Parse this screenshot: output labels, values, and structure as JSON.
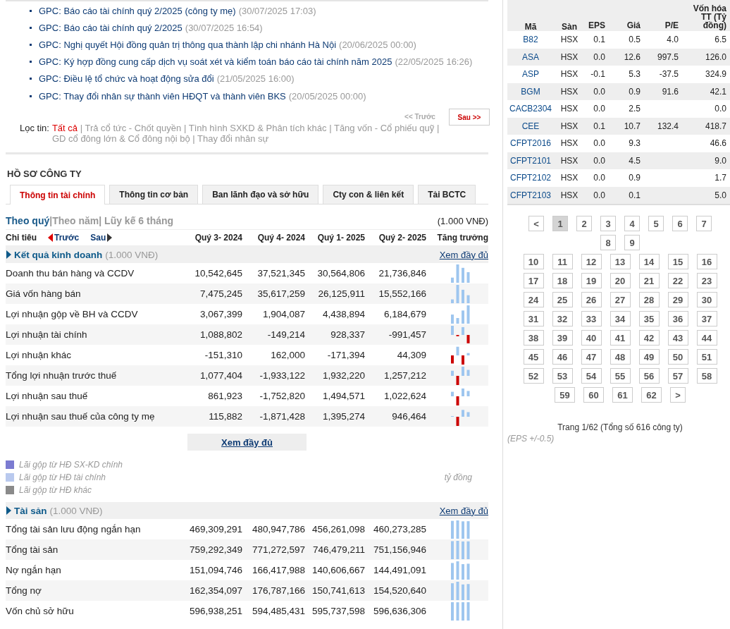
{
  "news": [
    {
      "title": "GPC: Báo cáo tài chính quý 2/2025 (công ty mẹ)",
      "date": "(30/07/2025 17:03)"
    },
    {
      "title": "GPC: Báo cáo tài chính quý 2/2025",
      "date": "(30/07/2025 16:54)"
    },
    {
      "title": "GPC: Nghị quyết Hội đồng quản trị thông qua thành lập chi nhánh Hà Nội",
      "date": "(20/06/2025 00:00)"
    },
    {
      "title": "GPC: Ký hợp đồng cung cấp dịch vụ soát xét và kiểm toán báo cáo tài chính năm 2025",
      "date": "(22/05/2025 16:26)"
    },
    {
      "title": "GPC: Điều lệ tổ chức và hoạt động sửa đổi",
      "date": "(21/05/2025 16:00)"
    },
    {
      "title": "GPC: Thay đổi nhân sự thành viên HĐQT và thành viên BKS",
      "date": "(20/05/2025 00:00)"
    }
  ],
  "news_pager": {
    "prev": "<< Trước",
    "next": "Sau >>"
  },
  "filter": {
    "label": "Lọc tin:",
    "separator": "|",
    "items": [
      {
        "label": "Tất cả",
        "selected": true
      },
      {
        "label": "Trả cổ tức - Chốt quyền",
        "selected": false
      },
      {
        "label": "Tình hình SXKD & Phân tích khác",
        "selected": false
      },
      {
        "label": "Tăng vốn - Cổ phiếu quỹ",
        "selected": false
      },
      {
        "label": "GD cổ đông lớn & Cổ đông nội bộ",
        "selected": false
      },
      {
        "label": "Thay đổi nhân sự",
        "selected": false
      }
    ]
  },
  "profile_title": "HỒ SƠ CÔNG TY",
  "tabs": [
    {
      "label": "Thông tin tài chính",
      "selected": true
    },
    {
      "label": "Thông tin cơ bản",
      "selected": false
    },
    {
      "label": "Ban lãnh đạo và sở hữu",
      "selected": false
    },
    {
      "label": "Cty con & liên kết",
      "selected": false
    },
    {
      "label": "Tải BCTC",
      "selected": false
    }
  ],
  "periods": {
    "separator": "|",
    "items": [
      {
        "label": "Theo quý",
        "selected": true
      },
      {
        "label": "Theo năm",
        "selected": false
      },
      {
        "label": "Lũy kế 6 tháng",
        "selected": false
      }
    ],
    "unit": "(1.000 VNĐ)"
  },
  "table_header": {
    "indicator": "Chỉ tiêu",
    "prev": "Trước",
    "next": "Sau",
    "columns": [
      "Quý 3- 2024",
      "Quý 4- 2024",
      "Quý 1- 2025",
      "Quý 2- 2025"
    ],
    "growth": "Tăng trưởng"
  },
  "sections": [
    {
      "title": "Kết quả kinh doanh",
      "unit": "(1.000 VNĐ)",
      "link": "Xem đầy đủ",
      "rows": [
        {
          "label": "Doanh thu bán hàng và CCDV",
          "values": [
            "10,542,645",
            "37,521,345",
            "30,564,806",
            "21,736,846"
          ]
        },
        {
          "label": "Giá vốn hàng bán",
          "values": [
            "7,475,245",
            "35,617,259",
            "26,125,911",
            "15,552,166"
          ]
        },
        {
          "label": "Lợi nhuận gộp về BH và CCDV",
          "values": [
            "3,067,399",
            "1,904,087",
            "4,438,894",
            "6,184,679"
          ]
        },
        {
          "label": "Lợi nhuận tài chính",
          "values": [
            "1,088,802",
            "-149,214",
            "928,337",
            "-991,457"
          ]
        },
        {
          "label": "Lợi nhuận khác",
          "values": [
            "-151,310",
            "162,000",
            "-171,394",
            "44,309"
          ]
        },
        {
          "label": "Tổng lợi nhuận trước thuế",
          "values": [
            "1,077,404",
            "-1,933,122",
            "1,932,220",
            "1,257,212"
          ]
        },
        {
          "label": "Lợi nhuận sau thuế",
          "values": [
            "861,923",
            "-1,752,820",
            "1,494,571",
            "1,022,624"
          ]
        },
        {
          "label": "Lợi nhuận sau thuế của công ty mẹ",
          "values": [
            "115,882",
            "-1,871,428",
            "1,395,274",
            "946,464"
          ]
        }
      ],
      "more_button": "Xem đầy đủ",
      "legend": {
        "items": [
          {
            "label": "Lãi gộp từ HĐ SX-KD chính",
            "color": "#7b7bd1"
          },
          {
            "label": "Lãi gộp từ HĐ tài chính",
            "color": "#b9c9ee"
          },
          {
            "label": "Lãi gộp từ HĐ khác",
            "color": "#8a8a8a"
          }
        ],
        "unit": "tỷ đồng"
      }
    },
    {
      "title": "Tài sản",
      "unit": "(1.000 VNĐ)",
      "link": "Xem đầy đủ",
      "rows": [
        {
          "label": "Tổng tài sản lưu động ngắn hạn",
          "values": [
            "469,309,291",
            "480,947,786",
            "456,261,098",
            "460,273,285"
          ]
        },
        {
          "label": "Tổng tài sản",
          "values": [
            "759,292,349",
            "771,272,597",
            "746,479,211",
            "751,156,946"
          ]
        },
        {
          "label": "Nợ ngắn hạn",
          "values": [
            "151,094,746",
            "166,417,988",
            "140,606,667",
            "144,491,091"
          ]
        },
        {
          "label": "Tổng nợ",
          "values": [
            "162,354,097",
            "176,787,166",
            "150,741,613",
            "154,520,640"
          ]
        },
        {
          "label": "Vốn chủ sở hữu",
          "values": [
            "596,938,251",
            "594,485,431",
            "595,737,598",
            "596,636,306"
          ]
        }
      ]
    }
  ],
  "stocks": {
    "columns": [
      "Mã",
      "Sàn",
      "EPS",
      "Giá",
      "P/E",
      "Vốn hóa TT (Tỷ đồng)"
    ],
    "rows": [
      {
        "code": "B82",
        "exchange": "HSX",
        "eps": "0.1",
        "price": "0.5",
        "pe": "4.0",
        "cap": "6.5"
      },
      {
        "code": "ASA",
        "exchange": "HSX",
        "eps": "0.0",
        "price": "12.6",
        "pe": "997.5",
        "cap": "126.0"
      },
      {
        "code": "ASP",
        "exchange": "HSX",
        "eps": "-0.1",
        "price": "5.3",
        "pe": "-37.5",
        "cap": "324.9"
      },
      {
        "code": "BGM",
        "exchange": "HSX",
        "eps": "0.0",
        "price": "0.9",
        "pe": "91.6",
        "cap": "42.1"
      },
      {
        "code": "CACB2304",
        "exchange": "HSX",
        "eps": "0.0",
        "price": "2.5",
        "cap": "0.0"
      },
      {
        "code": "CEE",
        "exchange": "HSX",
        "eps": "0.1",
        "price": "10.7",
        "pe": "132.4",
        "cap": "418.7"
      },
      {
        "code": "CFPT2016",
        "exchange": "HSX",
        "eps": "0.0",
        "price": "9.3",
        "cap": "46.6"
      },
      {
        "code": "CFPT2101",
        "exchange": "HSX",
        "eps": "0.0",
        "price": "4.5",
        "cap": "9.0"
      },
      {
        "code": "CFPT2102",
        "exchange": "HSX",
        "eps": "0.0",
        "price": "0.9",
        "cap": "1.7"
      },
      {
        "code": "CFPT2103",
        "exchange": "HSX",
        "eps": "0.0",
        "price": "0.1",
        "cap": "5.0"
      }
    ]
  },
  "pager": {
    "prev": "<",
    "first_pages": [
      {
        "label": "1",
        "selected": true
      },
      {
        "label": "2",
        "selected": false
      },
      {
        "label": "3",
        "selected": false
      },
      {
        "label": "4",
        "selected": false
      },
      {
        "label": "5",
        "selected": false
      },
      {
        "label": "6",
        "selected": false
      },
      {
        "label": "7",
        "selected": false
      },
      {
        "label": "8",
        "selected": false
      },
      {
        "label": "9",
        "selected": false
      }
    ],
    "more_pages": [
      {
        "label": "10",
        "selected": false
      },
      {
        "label": "11",
        "selected": false
      },
      {
        "label": "12",
        "selected": false
      },
      {
        "label": "13",
        "selected": false
      },
      {
        "label": "14",
        "selected": false
      },
      {
        "label": "15",
        "selected": false
      },
      {
        "label": "16",
        "selected": false
      },
      {
        "label": "17",
        "selected": false
      },
      {
        "label": "18",
        "selected": false
      },
      {
        "label": "19",
        "selected": false
      },
      {
        "label": "20",
        "selected": false
      },
      {
        "label": "21",
        "selected": false
      },
      {
        "label": "22",
        "selected": false
      },
      {
        "label": "23",
        "selected": false
      },
      {
        "label": "24",
        "selected": false
      },
      {
        "label": "25",
        "selected": false
      },
      {
        "label": "26",
        "selected": false
      },
      {
        "label": "27",
        "selected": false
      },
      {
        "label": "28",
        "selected": false
      },
      {
        "label": "29",
        "selected": false
      },
      {
        "label": "30",
        "selected": false
      },
      {
        "label": "31",
        "selected": false
      },
      {
        "label": "32",
        "selected": false
      },
      {
        "label": "33",
        "selected": false
      },
      {
        "label": "34",
        "selected": false
      },
      {
        "label": "35",
        "selected": false
      },
      {
        "label": "36",
        "selected": false
      },
      {
        "label": "37",
        "selected": false
      },
      {
        "label": "38",
        "selected": false
      },
      {
        "label": "39",
        "selected": false
      },
      {
        "label": "40",
        "selected": false
      },
      {
        "label": "41",
        "selected": false
      },
      {
        "label": "42",
        "selected": false
      },
      {
        "label": "43",
        "selected": false
      },
      {
        "label": "44",
        "selected": false
      },
      {
        "label": "45",
        "selected": false
      },
      {
        "label": "46",
        "selected": false
      },
      {
        "label": "47",
        "selected": false
      },
      {
        "label": "48",
        "selected": false
      },
      {
        "label": "49",
        "selected": false
      },
      {
        "label": "50",
        "selected": false
      },
      {
        "label": "51",
        "selected": false
      },
      {
        "label": "52",
        "selected": false
      },
      {
        "label": "53",
        "selected": false
      },
      {
        "label": "54",
        "selected": false
      },
      {
        "label": "55",
        "selected": false
      },
      {
        "label": "56",
        "selected": false
      },
      {
        "label": "57",
        "selected": false
      },
      {
        "label": "58",
        "selected": false
      },
      {
        "label": "59",
        "selected": false
      },
      {
        "label": "60",
        "selected": false
      },
      {
        "label": "61",
        "selected": false
      },
      {
        "label": "62",
        "selected": false
      }
    ],
    "next": ">",
    "summary": "Trang 1/62 (Tổng số 616 công ty)"
  },
  "eps_note": "(EPS +/-0.5)"
}
